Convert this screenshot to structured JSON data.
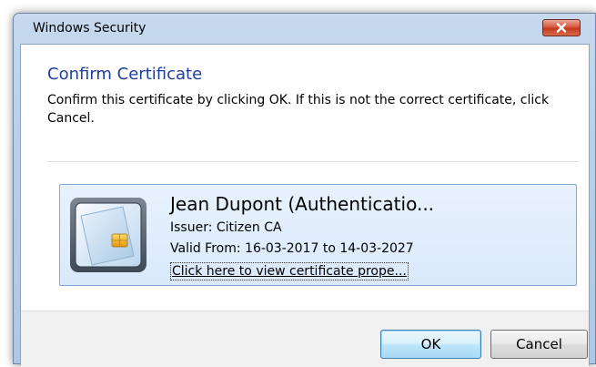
{
  "window": {
    "title": "Windows Security",
    "close_icon": "close-icon"
  },
  "dialog": {
    "heading": "Confirm Certificate",
    "description": "Confirm this certificate by clicking OK. If this is not the correct certificate, click Cancel."
  },
  "certificate": {
    "icon": "smart-card-icon",
    "name": "Jean Dupont  (Authenticatio...",
    "issuer": "Issuer: Citizen CA",
    "valid": "Valid From: 16-03-2017 to 14-03-2027",
    "link": "Click here to view certificate prope..."
  },
  "buttons": {
    "ok": "OK",
    "cancel": "Cancel"
  },
  "colors": {
    "heading": "#1e3f9c",
    "tile_border": "#7fa8d6",
    "close_button": "#c33a1e"
  }
}
